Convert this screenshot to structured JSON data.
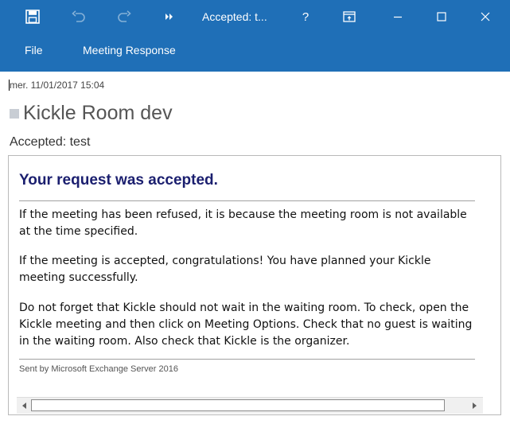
{
  "window": {
    "title": "Accepted: t...",
    "help_label": "?"
  },
  "ribbon": {
    "tabs": [
      {
        "label": "File"
      },
      {
        "label": "Meeting Response"
      }
    ]
  },
  "header": {
    "date": "mer. 11/01/2017 15:04",
    "sender": "Kickle Room dev",
    "subject": "Accepted: test"
  },
  "message": {
    "title": "Your request was accepted.",
    "paragraphs": [
      "If the meeting has been refused, it is because the meeting room is not available at the time specified.",
      "If the meeting is accepted, congratulations! You have planned your Kickle meeting successfully.",
      "Do not forget that Kickle should not wait in the waiting room. To check, open the Kickle meeting and then click on Meeting Options. Check that no guest is waiting in the waiting room. Also check that Kickle is the organizer."
    ],
    "footer": "Sent by Microsoft Exchange Server 2016"
  },
  "colors": {
    "titlebar": "#1f6fb7",
    "title_text": "#1b1f6f"
  },
  "icons": {
    "save": "save-icon",
    "undo": "undo-icon",
    "redo": "redo-icon",
    "more": "more-icon",
    "ribbon_display": "ribbon-display-icon",
    "minimize": "minimize-icon",
    "maximize": "maximize-icon",
    "close": "close-icon"
  }
}
